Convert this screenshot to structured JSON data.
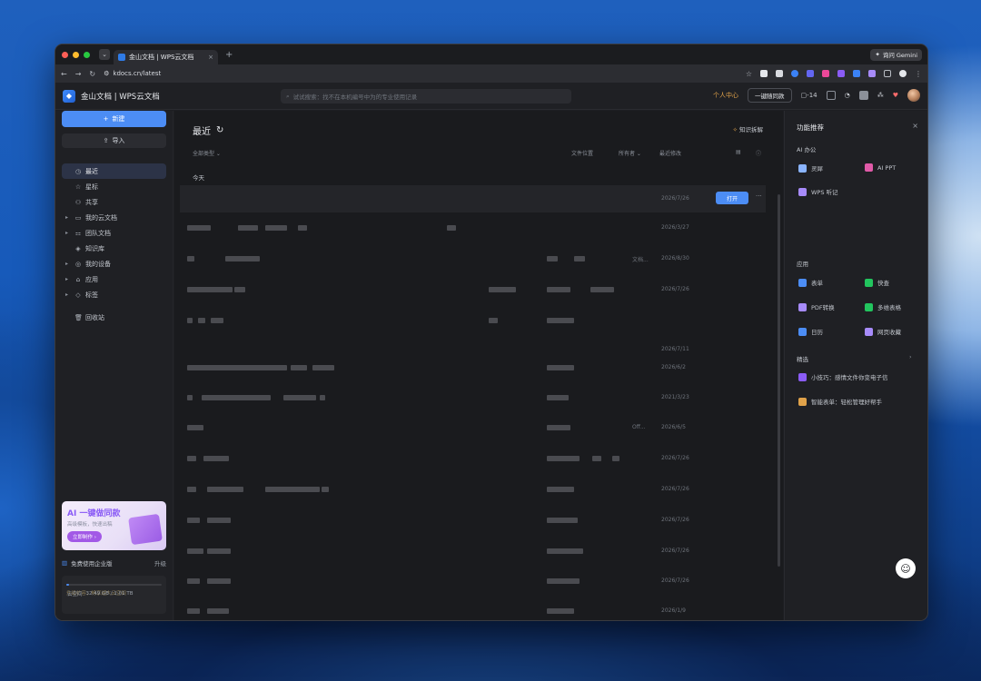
{
  "browser": {
    "tab_title": "金山文档 | WPS云文档",
    "tab_close": "×",
    "new_tab": "+",
    "tab_menu": "⌄",
    "gemini_label": "询问 Gemini",
    "url": "kdocs.cn/latest",
    "nav_back": "←",
    "nav_forward": "→",
    "nav_reload": "↻",
    "star": "☆"
  },
  "header": {
    "brand": "金山文档 | WPS云文档",
    "search_placeholder": "试试搜索：找不在本机编号中为的专业使用记录",
    "personal_center": "个人中心",
    "one_click_sync": "一键随同款",
    "count": "14"
  },
  "sidebar": {
    "new_label": "新建",
    "import_label": "导入",
    "items": [
      {
        "label": "最近",
        "icon": "clock-icon",
        "glyph": "◷",
        "caret": ""
      },
      {
        "label": "星标",
        "icon": "star-icon",
        "glyph": "☆",
        "caret": ""
      },
      {
        "label": "共享",
        "icon": "share-icon",
        "glyph": "⚇",
        "caret": ""
      },
      {
        "label": "我的云文档",
        "icon": "folder-icon",
        "glyph": "▭",
        "caret": "▸"
      },
      {
        "label": "团队文档",
        "icon": "team-icon",
        "glyph": "⚏",
        "caret": "▸"
      },
      {
        "label": "知识库",
        "icon": "knowledge-icon",
        "glyph": "◈",
        "caret": ""
      },
      {
        "label": "我的设备",
        "icon": "device-icon",
        "glyph": "◎",
        "caret": "▸"
      },
      {
        "label": "应用",
        "icon": "apps-icon",
        "glyph": "⌂",
        "caret": "▸"
      },
      {
        "label": "标签",
        "icon": "tag-icon",
        "glyph": "◇",
        "caret": "▸"
      },
      {
        "label": "回收站",
        "icon": "trash-icon",
        "glyph": "🗑",
        "caret": ""
      }
    ],
    "promo": {
      "title": "AI 一键做同款",
      "subtitle": "高级模板，快速出稿",
      "button": "立即制作 ›"
    },
    "enterprise": {
      "label": "免费使用企业版",
      "upgrade": "升级"
    },
    "storage": {
      "label": "云空间",
      "usage": "32.49 GB / 1.01 TB",
      "expand": "扩容",
      "tip": "升级扩容，畅享超大云空间",
      "fraction": 0.03
    }
  },
  "main": {
    "title": "最近",
    "refresh": "↻",
    "knowledge_btn": "知识拆解",
    "columns": {
      "type": "全部类型 ⌄",
      "location": "文件位置",
      "owner": "所有者 ⌄",
      "modified": "最近修改"
    },
    "group_today": "今天",
    "open_label": "打开",
    "more": "···",
    "rows": [
      {
        "date": "2026/7/26",
        "location": "",
        "selected": true
      },
      {
        "date": "2026/3/27",
        "location": ""
      },
      {
        "date": "2026/8/30",
        "location": "文档..."
      },
      {
        "date": "2026/7/26",
        "location": ""
      },
      {
        "date": "",
        "location": ""
      },
      {
        "date": "2026/7/11",
        "location": ""
      },
      {
        "date": "2026/6/2",
        "location": ""
      },
      {
        "date": "2021/3/23",
        "location": ""
      },
      {
        "date": "2026/6/5",
        "location": "Off..."
      },
      {
        "date": "2026/7/26",
        "location": ""
      },
      {
        "date": "2026/7/26",
        "location": ""
      },
      {
        "date": "2026/7/26",
        "location": ""
      },
      {
        "date": "2026/7/26",
        "location": ""
      },
      {
        "date": "2026/7/26",
        "location": ""
      },
      {
        "date": "2026/1/9",
        "location": ""
      }
    ]
  },
  "right_panel": {
    "title": "功能推荐",
    "close": "×",
    "section_ai": "AI 办公",
    "ai_items": [
      {
        "label": "灵犀",
        "icon": "lingxi-icon",
        "color": "#8ab4ff"
      },
      {
        "label": "AI PPT",
        "icon": "ai-ppt-icon",
        "color": "#e05aa8"
      },
      {
        "label": "WPS 听记",
        "icon": "listen-icon",
        "color": "#a78bfa"
      }
    ],
    "section_apps": "应用",
    "app_items": [
      {
        "label": "表单",
        "icon": "form-icon",
        "color": "#4c8df5"
      },
      {
        "label": "快查",
        "icon": "quick-icon",
        "color": "#22c55e"
      },
      {
        "label": "PDF转换",
        "icon": "pdf-icon",
        "color": "#a78bfa"
      },
      {
        "label": "多维表格",
        "icon": "table-icon",
        "color": "#22c55e"
      },
      {
        "label": "日历",
        "icon": "calendar-icon",
        "color": "#4c8df5"
      },
      {
        "label": "网页收藏",
        "icon": "bookmark-icon",
        "color": "#a78bfa"
      }
    ],
    "section_featured": "精选",
    "featured_items": [
      {
        "label": "小技巧：感情文件你变电子信",
        "icon": "tip-icon",
        "color": "#8b5cf6"
      },
      {
        "label": "智能表单：轻松管理好帮手",
        "icon": "smart-form-icon",
        "color": "#e0a24a"
      }
    ],
    "section_arrow": "›"
  },
  "colors": {
    "accent": "#4c8df5",
    "gold": "#e0a24a",
    "bg": "#1a1b1e"
  }
}
